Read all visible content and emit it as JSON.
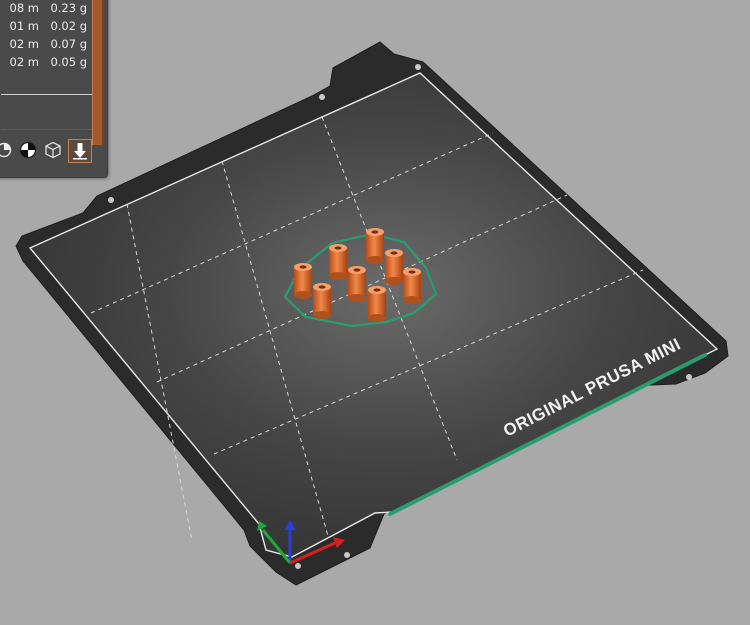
{
  "legend": {
    "rows": [
      {
        "length": "08 m",
        "weight": "0.23 g"
      },
      {
        "length": "01 m",
        "weight": "0.02 g"
      },
      {
        "length": "02 m",
        "weight": "0.07 g"
      },
      {
        "length": "02 m",
        "weight": "0.05 g"
      }
    ],
    "tool_icons": [
      "cut-view-icon",
      "pie-view-icon",
      "wireframe-cube-icon",
      "export-icon"
    ]
  },
  "bed": {
    "label": "ORIGINAL PRUSA MINI",
    "surface_color": "#3d3d3d",
    "edge_color": "#2a2a2a",
    "grid_color": "#d8d8d8",
    "accent_color": "#2a9d6f"
  },
  "objects": {
    "color": "#d9662a",
    "count": 8
  },
  "axes": {
    "x_color": "#d62020",
    "y_color": "#1fa83a",
    "z_color": "#2a3fd6"
  }
}
